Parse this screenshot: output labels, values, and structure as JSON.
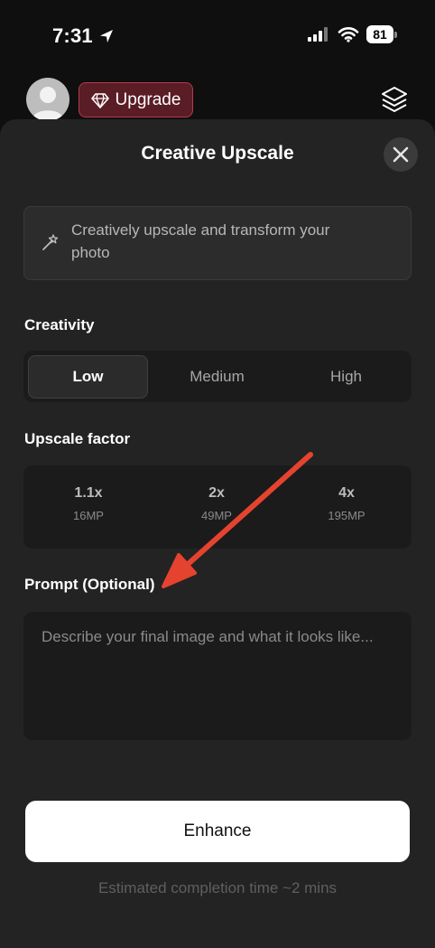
{
  "status_bar": {
    "time": "7:31",
    "battery": "81"
  },
  "header": {
    "upgrade_label": "Upgrade"
  },
  "sheet": {
    "title": "Creative Upscale",
    "info_text": "Creatively upscale and transform your photo",
    "creativity": {
      "label": "Creativity",
      "options": [
        "Low",
        "Medium",
        "High"
      ],
      "selected": "Low"
    },
    "upscale": {
      "label": "Upscale factor",
      "options": [
        {
          "factor": "1.1x",
          "mp": "16MP"
        },
        {
          "factor": "2x",
          "mp": "49MP"
        },
        {
          "factor": "4x",
          "mp": "195MP"
        }
      ]
    },
    "prompt": {
      "label": "Prompt (Optional)",
      "placeholder": "Describe your final image and what it looks like..."
    },
    "enhance_label": "Enhance",
    "estimate": "Estimated completion time ~2 mins"
  },
  "colors": {
    "annotation_arrow": "#e5432f",
    "upgrade_border": "#b33b4c",
    "upgrade_bg": "#5a1c25"
  }
}
